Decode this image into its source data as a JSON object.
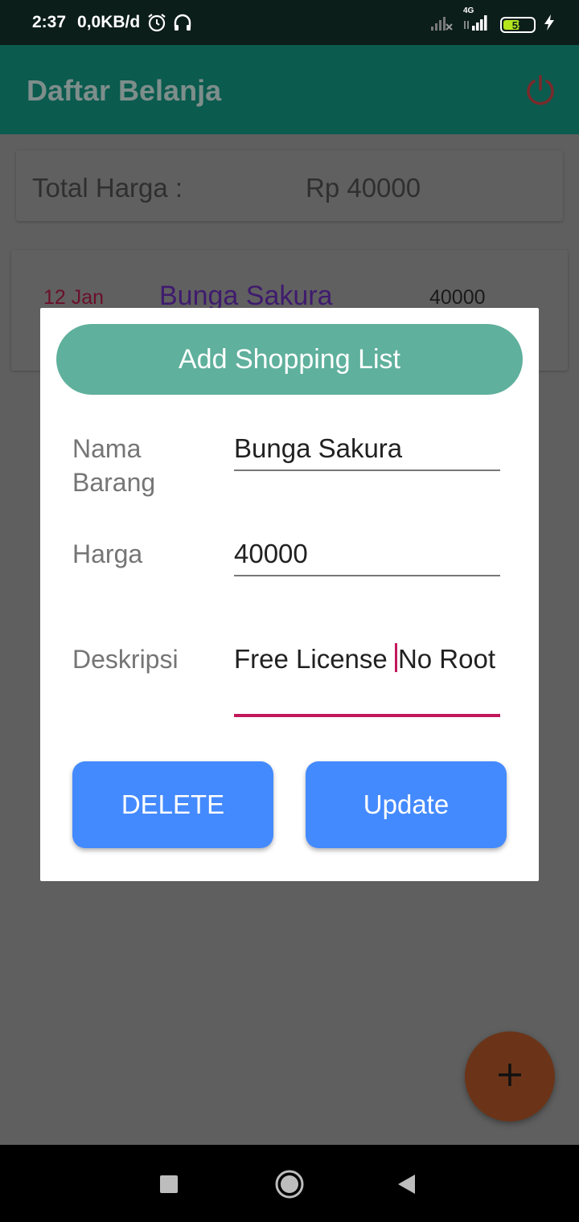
{
  "status_bar": {
    "time": "2:37",
    "network_speed": "0,0KB/d",
    "network_type": "4G",
    "battery_level": "55",
    "battery_fraction": 0.55,
    "icons": [
      "alarm-icon",
      "headphones-icon",
      "signal-no-service-icon",
      "signal-4g-icon",
      "battery-icon",
      "charging-icon"
    ]
  },
  "app_bar": {
    "title": "Daftar Belanja",
    "action_icon": "power-icon"
  },
  "summary": {
    "label": "Total Harga :",
    "value": "Rp 40000"
  },
  "list": {
    "items": [
      {
        "date": "12 Jan",
        "name": "Bunga Sakura",
        "price": "40000"
      }
    ]
  },
  "dialog": {
    "title": "Add Shopping List",
    "fields": {
      "name_label": "Nama Barang",
      "name_value": "Bunga Sakura",
      "price_label": "Harga",
      "price_value": "40000",
      "desc_label": "Deskripsi",
      "desc_value_before_cursor": "Free License ",
      "desc_value_after_cursor": "No Root"
    },
    "delete_label": "DELETE",
    "update_label": "Update"
  },
  "fab": {
    "icon": "plus-icon"
  },
  "nav_bar": {
    "icons": [
      "recents-icon",
      "home-icon",
      "back-icon"
    ]
  },
  "colors": {
    "header_accent": "#5fb09c",
    "button_blue": "#448aff",
    "active_underline": "#c2185b"
  }
}
